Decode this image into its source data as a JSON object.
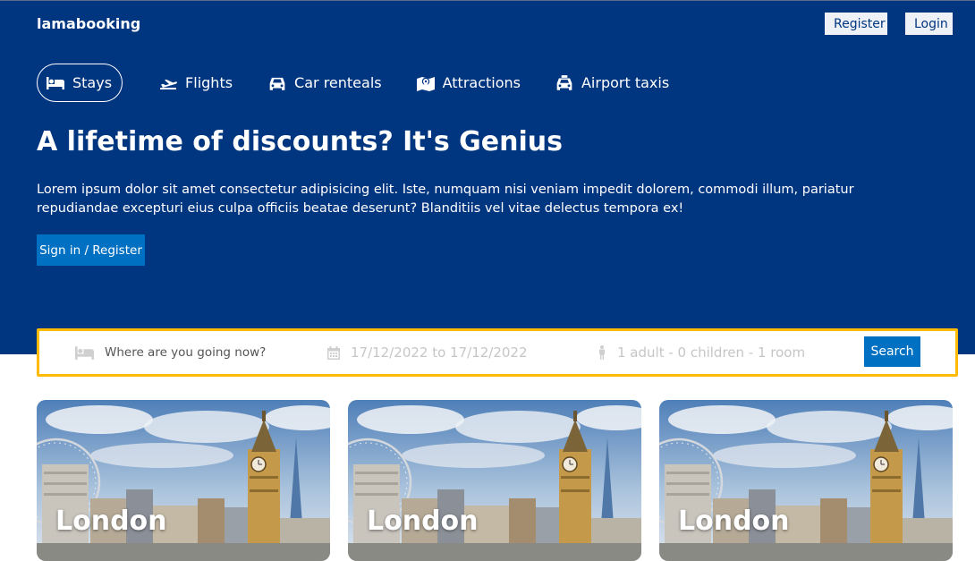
{
  "colors": {
    "brand": "#003580",
    "accent": "#0071c2",
    "search_border": "#febb02"
  },
  "header": {
    "logo": "lamabooking",
    "register_label": "Register",
    "login_label": "Login"
  },
  "tabs": [
    {
      "label": "Stays",
      "icon": "bed-icon",
      "active": true
    },
    {
      "label": "Flights",
      "icon": "plane-icon",
      "active": false
    },
    {
      "label": "Car renteals",
      "icon": "car-icon",
      "active": false
    },
    {
      "label": "Attractions",
      "icon": "map-pin-icon",
      "active": false
    },
    {
      "label": "Airport taxis",
      "icon": "taxi-icon",
      "active": false
    }
  ],
  "hero": {
    "title": "A lifetime of discounts? It's Genius",
    "description": "Lorem ipsum dolor sit amet consectetur adipisicing elit. Iste, numquam nisi veniam impedit dolorem, commodi illum, pariatur repudiandae excepturi eius culpa officiis beatae deserunt? Blanditiis vel vitae delectus tempora ex!",
    "cta_label": "Sign in / Register"
  },
  "search": {
    "destination_placeholder": "Where are you going now?",
    "date_range": "17/12/2022 to 17/12/2022",
    "options": "1 adult - 0 children - 1 room",
    "button_label": "Search"
  },
  "cards": [
    {
      "title": "London"
    },
    {
      "title": "London"
    },
    {
      "title": "London"
    }
  ]
}
